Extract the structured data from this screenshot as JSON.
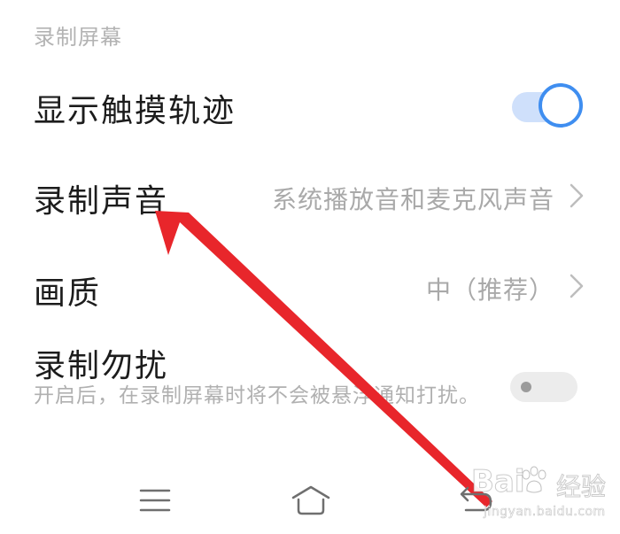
{
  "section": {
    "header": "录制屏幕"
  },
  "settings": [
    {
      "title": "显示触摸轨迹",
      "control": "toggle",
      "toggle_on": true
    },
    {
      "title": "录制声音",
      "value": "系统播放音和麦克风声音",
      "control": "chevron-right-icon"
    },
    {
      "title": "画质",
      "value": "中（推荐）",
      "control": "chevron-right-icon"
    },
    {
      "title": "录制勿扰",
      "subtitle": "开启后，在录制屏幕时将不会被悬浮通知打扰。",
      "control": "toggle",
      "toggle_on": false
    }
  ],
  "navbar": {
    "icons": [
      "menu-icon",
      "home-icon",
      "back-icon"
    ]
  },
  "colors": {
    "accent": "#3f8ef0",
    "toggle_track_on": "#cfe0fb",
    "toggle_track_off": "#ececec",
    "annotation_arrow": "#e8262b",
    "title_text": "#1c1c1c",
    "secondary_text": "#a9a9a9"
  },
  "watermark": {
    "logo_text": "Bai",
    "logo_cn": "经验",
    "url": "jingyan.baidu.com"
  }
}
